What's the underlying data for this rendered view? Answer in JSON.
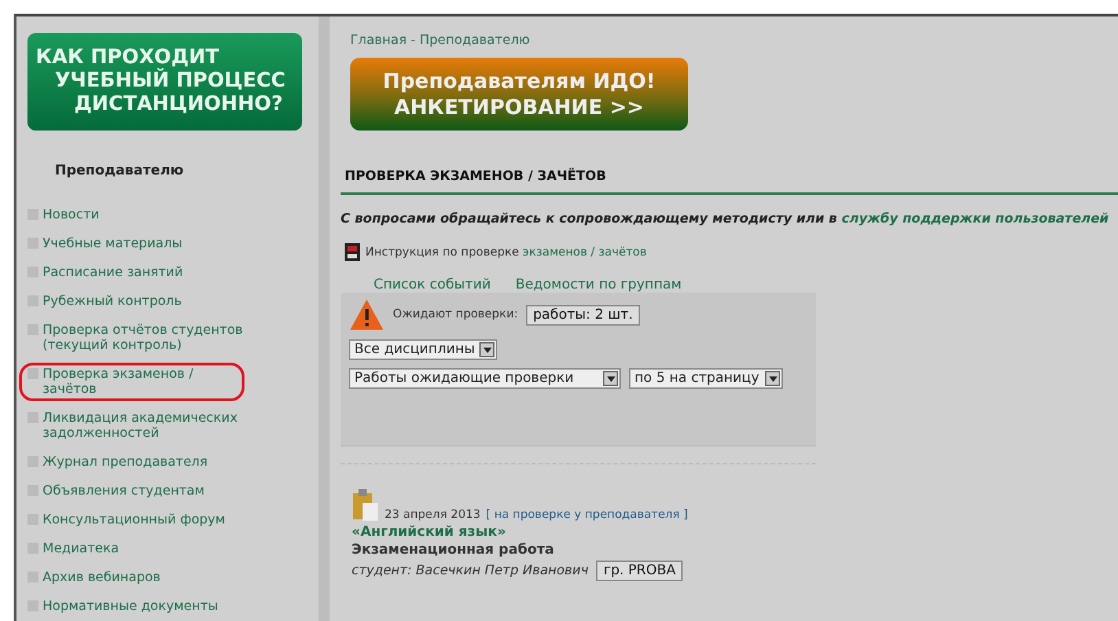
{
  "banner": {
    "lines": [
      "КАК ПРОХОДИТ",
      "УЧЕБНЫЙ ПРОЦЕСС",
      "ДИСТАНЦИОННО?"
    ]
  },
  "sidebar": {
    "title": "Преподавателю",
    "items": [
      {
        "label": "Новости",
        "selected": false
      },
      {
        "label": "Учебные материалы",
        "selected": false
      },
      {
        "label": "Расписание занятий",
        "selected": false
      },
      {
        "label": "Рубежный контроль",
        "selected": false
      },
      {
        "label": "Проверка отчётов студентов (текущий контроль)",
        "selected": false
      },
      {
        "label": "Проверка экзаменов / зачётов",
        "selected": true
      },
      {
        "label": "Ликвидация академических задолженностей",
        "selected": false
      },
      {
        "label": "Журнал преподавателя",
        "selected": false
      },
      {
        "label": "Объявления студентам",
        "selected": false
      },
      {
        "label": "Консультационный форум",
        "selected": false
      },
      {
        "label": "Медиатека",
        "selected": false
      },
      {
        "label": "Архив вебинаров",
        "selected": false
      },
      {
        "label": "Нормативные документы",
        "selected": false
      }
    ]
  },
  "breadcrumb": "Главная - Преподавателю",
  "promo": {
    "lines": [
      "Преподавателям ИДО!",
      "АНКЕТИРОВАНИЕ >>"
    ]
  },
  "heading": "ПРОВЕРКА ЭКЗАМЕНОВ / ЗАЧЁТОВ",
  "notice": {
    "text": "С вопросами обращайтесь к сопровождающему методисту или в",
    "link": "службу поддержки пользователей"
  },
  "instruction": {
    "text": "Инструкция по проверке",
    "link": "экзаменов / зачётов"
  },
  "tabs": [
    {
      "label": "Список событий"
    },
    {
      "label": "Ведомости по группам"
    }
  ],
  "pending": {
    "label": "Ожидают проверки:",
    "button": "работы: 2 шт."
  },
  "filters": {
    "discipline": "Все дисциплины",
    "status": "Работы ожидающие проверки",
    "per_page": "по 5 на страницу"
  },
  "works": [
    {
      "date": "23 апреля 2013",
      "status": "[ на проверке у преподавателя ]",
      "course": "«Английский язык»",
      "type": "Экзаменационная работа",
      "student": "студент: Васечкин Петр Иванович",
      "group": "гр. PROBA"
    }
  ]
}
